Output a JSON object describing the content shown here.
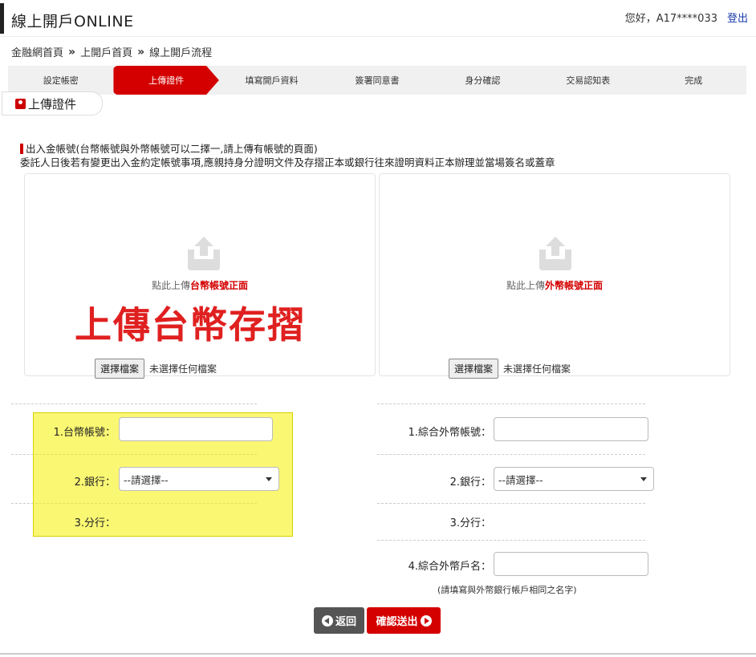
{
  "header": {
    "title": "線上開戶ONLINE",
    "greeting": "您好，A17****033",
    "logout": "登出"
  },
  "breadcrumb": [
    "金融網首頁",
    "上開戶首頁",
    "線上開戶流程"
  ],
  "breadcrumb_sep": "»",
  "steps": [
    "設定帳密",
    "上傳證件",
    "填寫開戶資料",
    "簽署同意書",
    "身分確認",
    "交易認知表",
    "完成"
  ],
  "active_step": 1,
  "section_tab": "上傳證件",
  "notice": {
    "line1": "出入金帳號(台幣帳號與外幣帳號可以二擇一,請上傳有帳號的頁面)",
    "line2": "委託人日後若有變更出入金約定帳號事項,應親持身分證明文件及存摺正本或銀行往來證明資料正本辦理並當場簽名或蓋章"
  },
  "upload_left": {
    "caption_prefix": "點此上傳",
    "caption_highlight": "台幣帳號正面",
    "big_label": "上傳台幣存摺",
    "file_button": "選擇檔案",
    "file_status": "未選擇任何檔案"
  },
  "upload_right": {
    "caption_prefix": "點此上傳",
    "caption_highlight": "外幣帳號正面",
    "file_button": "選擇檔案",
    "file_status": "未選擇任何檔案"
  },
  "form_left": {
    "account_label": "1.台幣帳號：",
    "account_value": "",
    "bank_label": "2.銀行：",
    "bank_selected": "--請選擇--",
    "branch_label": "3.分行："
  },
  "form_right": {
    "account_label": "1.綜合外幣帳號：",
    "account_value": "",
    "bank_label": "2.銀行：",
    "bank_selected": "--請選擇--",
    "branch_label": "3.分行：",
    "name_label": "4.綜合外幣戶名：",
    "name_value": "",
    "note": "(請填寫與外幣銀行帳戶相同之名字)"
  },
  "buttons": {
    "back": "返回",
    "submit": "確認送出"
  },
  "colors": {
    "accent": "#d40000",
    "highlight": "#f6f000"
  }
}
